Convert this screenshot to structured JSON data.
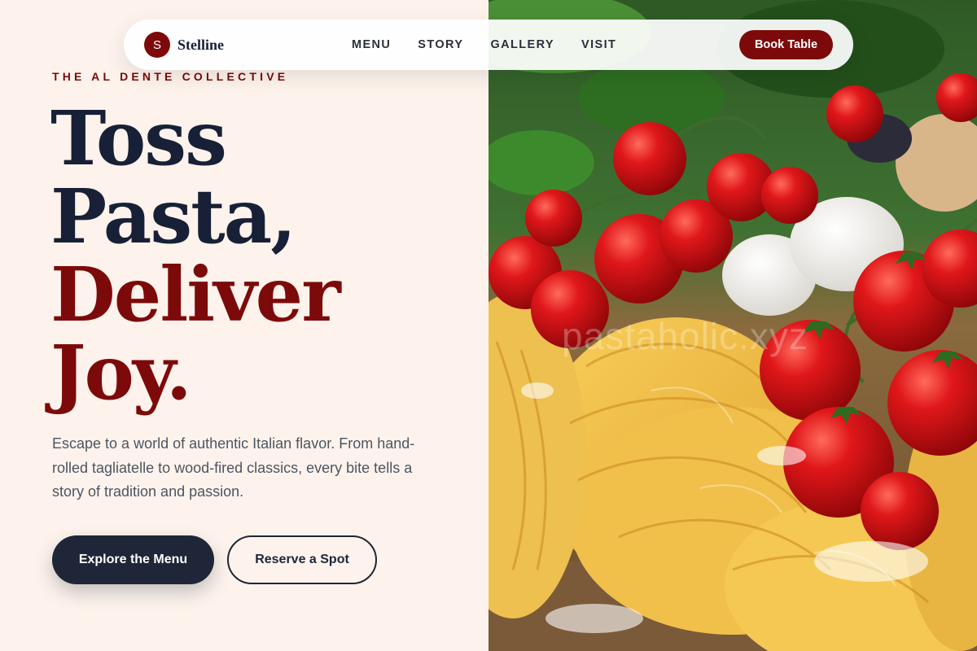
{
  "brand": {
    "mark": "S",
    "name": "Stelline"
  },
  "nav": {
    "links": [
      "MENU",
      "STORY",
      "GALLERY",
      "VISIT"
    ],
    "cta": "Book Table"
  },
  "hero": {
    "eyebrow": "THE AL DENTE COLLECTIVE",
    "headline": [
      "Toss",
      "Pasta,",
      "Deliver",
      "Joy."
    ],
    "lead": "Escape to a world of authentic Italian flavor. From hand-rolled tagliatelle to wood-fired classics, every bite tells a story of tradition and passion.",
    "primary_cta": "Explore the Menu",
    "secondary_cta": "Reserve a Spot"
  },
  "image": {
    "watermark": "pastaholic.xyz",
    "subject": "fresh pasta nests with cherry tomatoes and eggs"
  },
  "colors": {
    "background": "#fdf3ec",
    "accent": "#7d0a0a",
    "navy": "#172036",
    "button_dark": "#1e2638",
    "text_muted": "#4b5563"
  }
}
